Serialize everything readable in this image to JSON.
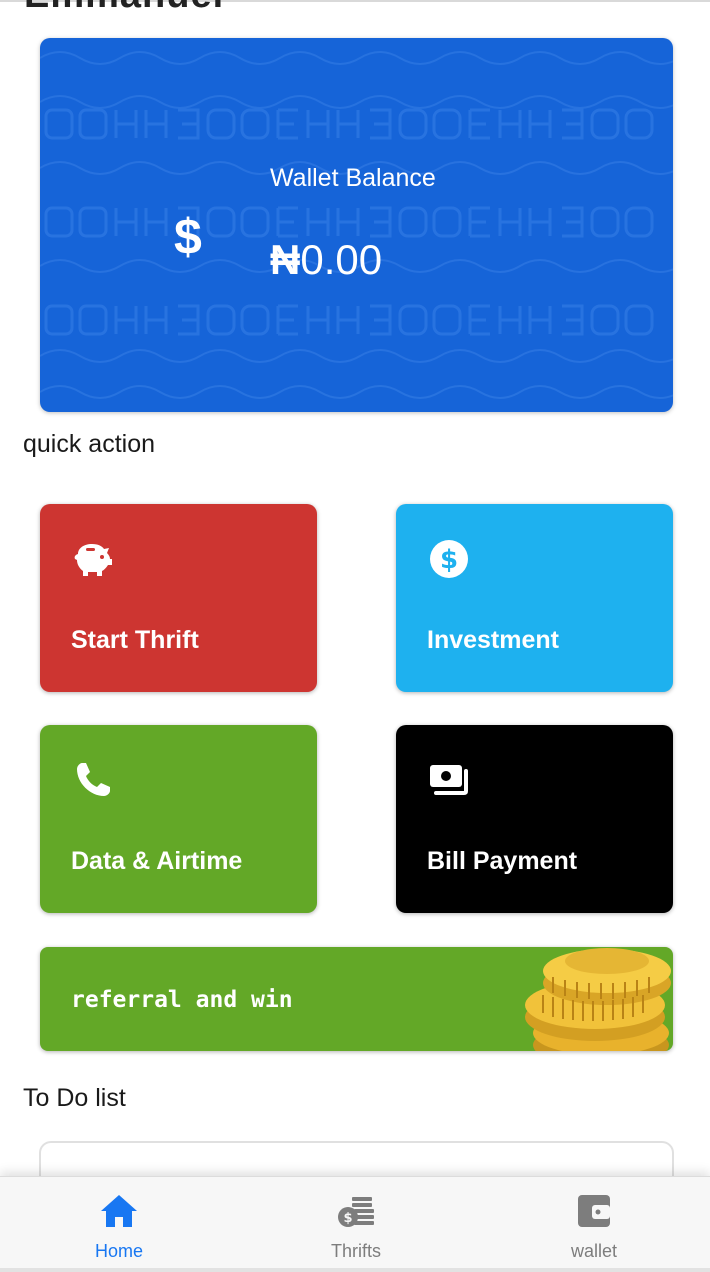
{
  "header": {
    "title": "Emmanuel"
  },
  "wallet": {
    "label": "Wallet Balance",
    "currency_symbol": "₦",
    "amount": "0.00",
    "dollar_glyph": "$",
    "card_color": "#1664d8"
  },
  "quick_action": {
    "heading": "quick action",
    "items": [
      {
        "label": "Start Thrift",
        "icon": "piggy-bank-icon",
        "color": "#cd3531"
      },
      {
        "label": "Investment",
        "icon": "dollar-circle-icon",
        "color": "#1eb1ef"
      },
      {
        "label": "Data & Airtime",
        "icon": "phone-icon",
        "color": "#63a827"
      },
      {
        "label": "Bill Payment",
        "icon": "money-bill-icon",
        "color": "#000000"
      }
    ]
  },
  "referral": {
    "label": "referral and win",
    "icon": "gold-coins-image",
    "color": "#63a827"
  },
  "todo": {
    "heading": "To Do list"
  },
  "bottom_nav": {
    "items": [
      {
        "label": "Home",
        "icon": "home-icon",
        "active": true
      },
      {
        "label": "Thrifts",
        "icon": "coins-stack-icon",
        "active": false
      },
      {
        "label": "wallet",
        "icon": "wallet-icon",
        "active": false
      }
    ],
    "active_color": "#1877f2",
    "inactive_color": "#7d7d7d"
  }
}
